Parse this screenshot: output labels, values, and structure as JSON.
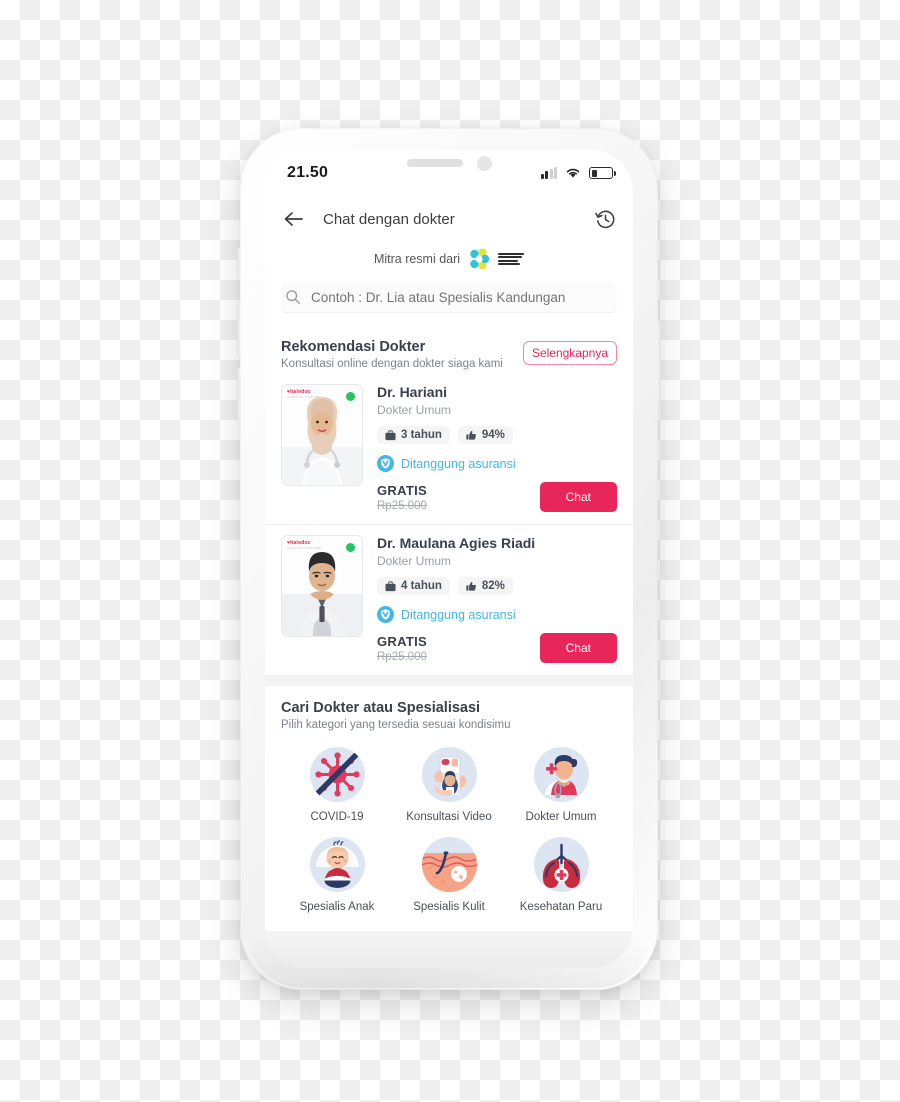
{
  "background": {
    "type": "transparency-checkerboard",
    "light": "#ffffff",
    "dark": "#efefef"
  },
  "phone": {
    "frame_color": "#f3f3f3"
  },
  "statusbar": {
    "time": "21.50",
    "signal_icon": "signal-bars-icon",
    "wifi_icon": "wifi-icon",
    "battery_icon": "battery-icon",
    "battery_level_pct": 30
  },
  "appbar": {
    "back_icon": "back-arrow-icon",
    "title": "Chat dengan dokter",
    "history_icon": "history-clock-icon"
  },
  "partner": {
    "label": "Mitra resmi dari",
    "logo_name": "kemenkes-logo",
    "logo_colors": {
      "cyan": "#2ec4d9",
      "yellow": "#e8e336",
      "text": "#2e2e2e"
    },
    "logo_text": "KEMENTERIAN KESEHATAN REPUBLIK INDONESIA"
  },
  "search": {
    "icon": "search-icon",
    "value": "",
    "placeholder": "Contoh : Dr. Lia atau Spesialis Kandungan"
  },
  "recommendation": {
    "title": "Rekomendasi Dokter",
    "subtitle": "Konsultasi online dengan dokter siaga kami",
    "more_label": "Selengkapnya",
    "accent_color": "#e8265a",
    "doctors": [
      {
        "name": "Dr. Hariani",
        "specialty": "Dokter Umum",
        "experience": "3 tahun",
        "rating": "94%",
        "insurance_label": "Ditanggung asuransi",
        "price_free": "GRATIS",
        "price_old": "Rp25.000",
        "chat_label": "Chat",
        "online": true,
        "photo_watermark": "halodoc",
        "photo_watermark_sub": "ALWAYS BY YOUR SIDE"
      },
      {
        "name": "Dr. Maulana Agies Riadi",
        "specialty": "Dokter Umum",
        "experience": "4 tahun",
        "rating": "82%",
        "insurance_label": "Ditanggung asuransi",
        "price_free": "GRATIS",
        "price_old": "Rp25.000",
        "chat_label": "Chat",
        "online": true,
        "photo_watermark": "halodoc",
        "photo_watermark_sub": "ALWAYS BY YOUR SIDE"
      }
    ]
  },
  "categories": {
    "title": "Cari Dokter atau Spesialisasi",
    "subtitle": "Pilih kategori yang tersedia sesuai kondisimu",
    "items": [
      {
        "label": "COVID-19",
        "icon": "virus-crossed-icon"
      },
      {
        "label": "Konsultasi Video",
        "icon": "video-consult-icon"
      },
      {
        "label": "Dokter Umum",
        "icon": "general-doctor-icon"
      },
      {
        "label": "Spesialis Anak",
        "icon": "baby-pediatric-icon"
      },
      {
        "label": "Spesialis Kulit",
        "icon": "skin-derma-icon"
      },
      {
        "label": "Kesehatan Paru",
        "icon": "lungs-icon"
      }
    ]
  }
}
